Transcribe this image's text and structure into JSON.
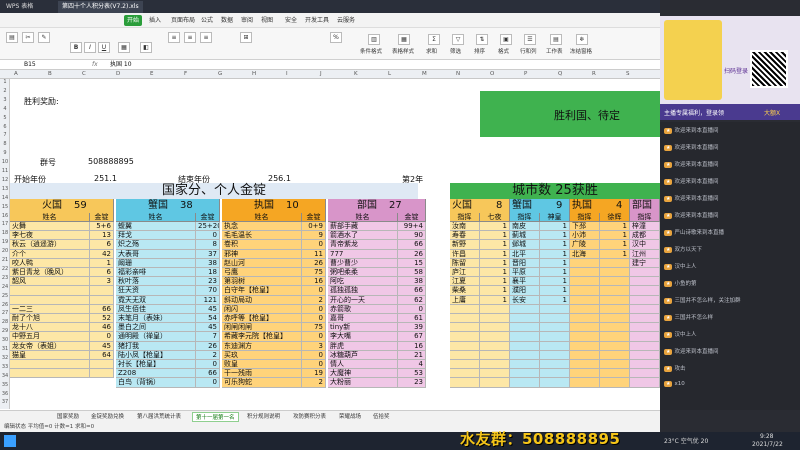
{
  "title_tabs": [
    "WPS 表格",
    "第四十个人积分表(V7.2).xls"
  ],
  "ribbon_tabs": [
    "开始",
    "插入",
    "页面布局",
    "公式",
    "数据",
    "审阅",
    "视图",
    "安全",
    "开发工具",
    "云服务"
  ],
  "ribbon_labels": {
    "cond": "条件格式",
    "table": "表格样式",
    "sum": "求和",
    "filter": "筛选",
    "sort": "排序",
    "format": "格式",
    "rowcol": "行和列",
    "sheet": "工作表",
    "freeze": "冻结窗格"
  },
  "formula": {
    "cellref": "B15",
    "fx": "fx",
    "value": "执国 10"
  },
  "colheads": [
    "A",
    "B",
    "C",
    "D",
    "E",
    "F",
    "G",
    "H",
    "I",
    "J",
    "K",
    "L",
    "M",
    "N",
    "O",
    "P",
    "Q",
    "R",
    "S"
  ],
  "rows": [
    "1",
    "2",
    "3",
    "4",
    "5",
    "6",
    "7",
    "8",
    "9",
    "10",
    "11",
    "12",
    "13",
    "14",
    "15",
    "16",
    "17",
    "18",
    "19",
    "20",
    "21",
    "22",
    "23",
    "24",
    "25",
    "26",
    "27",
    "28",
    "29",
    "30",
    "31",
    "32",
    "33",
    "34",
    "35",
    "36",
    "37"
  ],
  "top": {
    "win_reward": "胜利奖励:",
    "win_country": "胜利国、待定",
    "group_no_label": "群号",
    "group_no": "508888895",
    "start_label": "开始年份",
    "start_val": "251.1",
    "end_label": "结束年份",
    "end_val": "256.1",
    "year_label": "第2年"
  },
  "banner_left": "国家分、个人金锭",
  "banner_right": "城市数 25获胜",
  "nations": [
    {
      "name": "火国",
      "score": "59",
      "color": "#fde7a6",
      "headcolor": "#f7c75a"
    },
    {
      "name": "蟹国",
      "score": "38",
      "color": "#b9e8f3",
      "headcolor": "#5fc7e3"
    },
    {
      "name": "执国",
      "score": "10",
      "color": "#ffd37a",
      "headcolor": "#f5a623"
    },
    {
      "name": "部国",
      "score": "27",
      "color": "#f0c7e6",
      "headcolor": "#d895c9"
    }
  ],
  "col_name": "姓名",
  "col_gold": "金锭",
  "fire": [
    [
      "火舞",
      "5+6"
    ],
    [
      "李七夜",
      "13"
    ],
    [
      "秋云（逍遥游）",
      "6"
    ],
    [
      "介个",
      "42"
    ],
    [
      "咬人鸭",
      "1"
    ],
    [
      "紫日青龙（晚风）",
      "6"
    ],
    [
      "韶风",
      "3"
    ],
    [
      "",
      ""
    ],
    [
      "",
      ""
    ],
    [
      "一二三",
      "66"
    ],
    [
      "耐了个旭",
      "52"
    ],
    [
      "龙十八",
      "46"
    ],
    [
      "中野五月",
      "0"
    ],
    [
      "龙女帝（表姐）",
      "45"
    ],
    [
      "猫皇",
      "64"
    ],
    [
      "",
      ""
    ],
    [
      "",
      ""
    ]
  ],
  "crab": [
    [
      "蝮翼",
      "25+20"
    ],
    [
      "拜戈",
      "0"
    ],
    [
      "炽之殇",
      "8"
    ],
    [
      "大表哥",
      "37"
    ],
    [
      "阚珊",
      "38"
    ],
    [
      "福彩亲啡",
      "18"
    ],
    [
      "秋叶落",
      "23"
    ],
    [
      "狂天资",
      "70"
    ],
    [
      "霓天无双",
      "121"
    ],
    [
      "凤生佰佳",
      "45"
    ],
    [
      "末笔月（表妹）",
      "54"
    ],
    [
      "墨白之间",
      "45"
    ],
    [
      "通明殿（禅皇）",
      "7"
    ],
    [
      "猪打我",
      "26"
    ],
    [
      "陆小凤【枪皇】",
      "2"
    ],
    [
      "衬长【枪皇】",
      "0"
    ],
    [
      "Z208",
      "66"
    ],
    [
      "白鸟（背锅）",
      "0"
    ]
  ],
  "zhi": [
    [
      "执念",
      "0+9"
    ],
    [
      "毛毛温长",
      "9"
    ],
    [
      "卷积",
      "0"
    ],
    [
      "邪神",
      "11"
    ],
    [
      "赵山河",
      "26"
    ],
    [
      "弓鹰",
      "75"
    ],
    [
      "第羽树",
      "16"
    ],
    [
      "白守年【枪皇】",
      "0"
    ],
    [
      "斜动局动",
      "2"
    ],
    [
      "闲闪",
      "0"
    ],
    [
      "赤呼等【枪皇】",
      "0"
    ],
    [
      "闲闸闲闸",
      "75"
    ],
    [
      "希藏李元院【枪皇】",
      "0"
    ],
    [
      "东迪渊方",
      "3"
    ],
    [
      "买玖",
      "0"
    ],
    [
      "败皇",
      "0"
    ],
    [
      "干一残雨",
      "19"
    ],
    [
      "可乐狗蛇",
      "2"
    ]
  ],
  "bu": [
    [
      "薪部手藏",
      "99+4"
    ],
    [
      "箭酒水了",
      "90"
    ],
    [
      "青帝紫龙",
      "66"
    ],
    [
      "777",
      "26"
    ],
    [
      "曹少曹少",
      "15"
    ],
    [
      "粥吧柔柔",
      "58"
    ],
    [
      "阿吃",
      "38"
    ],
    [
      "孤独孤独",
      "66"
    ],
    [
      "开心的一天",
      "62"
    ],
    [
      "赤箭歌",
      "0"
    ],
    [
      "嘉哥",
      "61"
    ],
    [
      "tiny新",
      "39"
    ],
    [
      "李大嘴",
      "67"
    ],
    [
      "胖虎",
      "16"
    ],
    [
      "冰糖葫芦",
      "21"
    ],
    [
      "情人",
      "4"
    ],
    [
      "大魔神",
      "53"
    ],
    [
      "大粉丽",
      "23"
    ]
  ],
  "city_groups": [
    {
      "name": "火国",
      "score": "8",
      "color": "#fde7a6",
      "headcolor": "#f7c75a"
    },
    {
      "name": "蟹国",
      "score": "9",
      "color": "#b9e8f3",
      "headcolor": "#5fc7e3"
    },
    {
      "name": "执国",
      "score": "4",
      "color": "#ffd37a",
      "headcolor": "#f5a623"
    },
    {
      "name": "部国",
      "score": "",
      "color": "#f0c7e6",
      "headcolor": "#d895c9"
    }
  ],
  "city_cols": {
    "a": "指挥",
    "b": "七夜",
    "c": "指挥",
    "d": "神皇",
    "e": "指挥",
    "f": "徐辉",
    "g": "指挥"
  },
  "cities_fire": [
    [
      "汝南",
      "1"
    ],
    [
      "寿春",
      "1"
    ],
    [
      "新野",
      "1"
    ],
    [
      "许昌",
      "1"
    ],
    [
      "陈留",
      "1"
    ],
    [
      "庐江",
      "1"
    ],
    [
      "江夏",
      "1"
    ],
    [
      "柴桑",
      "1"
    ],
    [
      "上庸",
      "1"
    ]
  ],
  "cities_crab": [
    [
      "南皮",
      "1"
    ],
    [
      "蓟城",
      "1"
    ],
    [
      "邺城",
      "1"
    ],
    [
      "北平",
      "1"
    ],
    [
      "晋阳",
      "1"
    ],
    [
      "平原",
      "1"
    ],
    [
      "襄平",
      "1"
    ],
    [
      "濮阳",
      "1"
    ],
    [
      "长安",
      "1"
    ]
  ],
  "cities_zhi": [
    [
      "下邳",
      "1"
    ],
    [
      "小沛",
      "1"
    ],
    [
      "广陵",
      "1"
    ],
    [
      "北海",
      "1"
    ]
  ],
  "cities_bu": [
    [
      "梓潼"
    ],
    [
      "成都"
    ],
    [
      "汉中"
    ],
    [
      "江州"
    ],
    [
      "建宁"
    ]
  ],
  "sheet_tabs": [
    "国家奖励",
    "金锭奖励兑换",
    "第八届洪荒统计表",
    "第十一届第一名",
    "积分规则说明",
    "攻防赛积分表",
    "荣耀战场",
    "伍拾奖"
  ],
  "active_tab": "第十一届第一名",
  "status": "编辑状态  平均值=0  计数=1  求和=0",
  "fan_group": "水友群：508888895",
  "stream": {
    "ad_title": "扫码登录",
    "ad_promo": "主播专属福利，登录领",
    "ad_credit": "大额X"
  },
  "chat": [
    "欢迎来到本直播间",
    "欢迎来到本直播间",
    "欢迎来到本直播间",
    "欢迎来到本直播间",
    "欢迎来到本直播间",
    "欢迎来到本直播间",
    "严山诗歌来到本直播",
    "双方以天下",
    "汉中上人",
    "小鱼的第",
    "三国并不怎么样，关注加群",
    "三国并不怎么样",
    "汉中上人",
    "欢迎来到本直播间",
    "攻击",
    "x10"
  ],
  "clock": "9:28",
  "date": "2021/7/22",
  "weather": "23°C 空气优 20"
}
